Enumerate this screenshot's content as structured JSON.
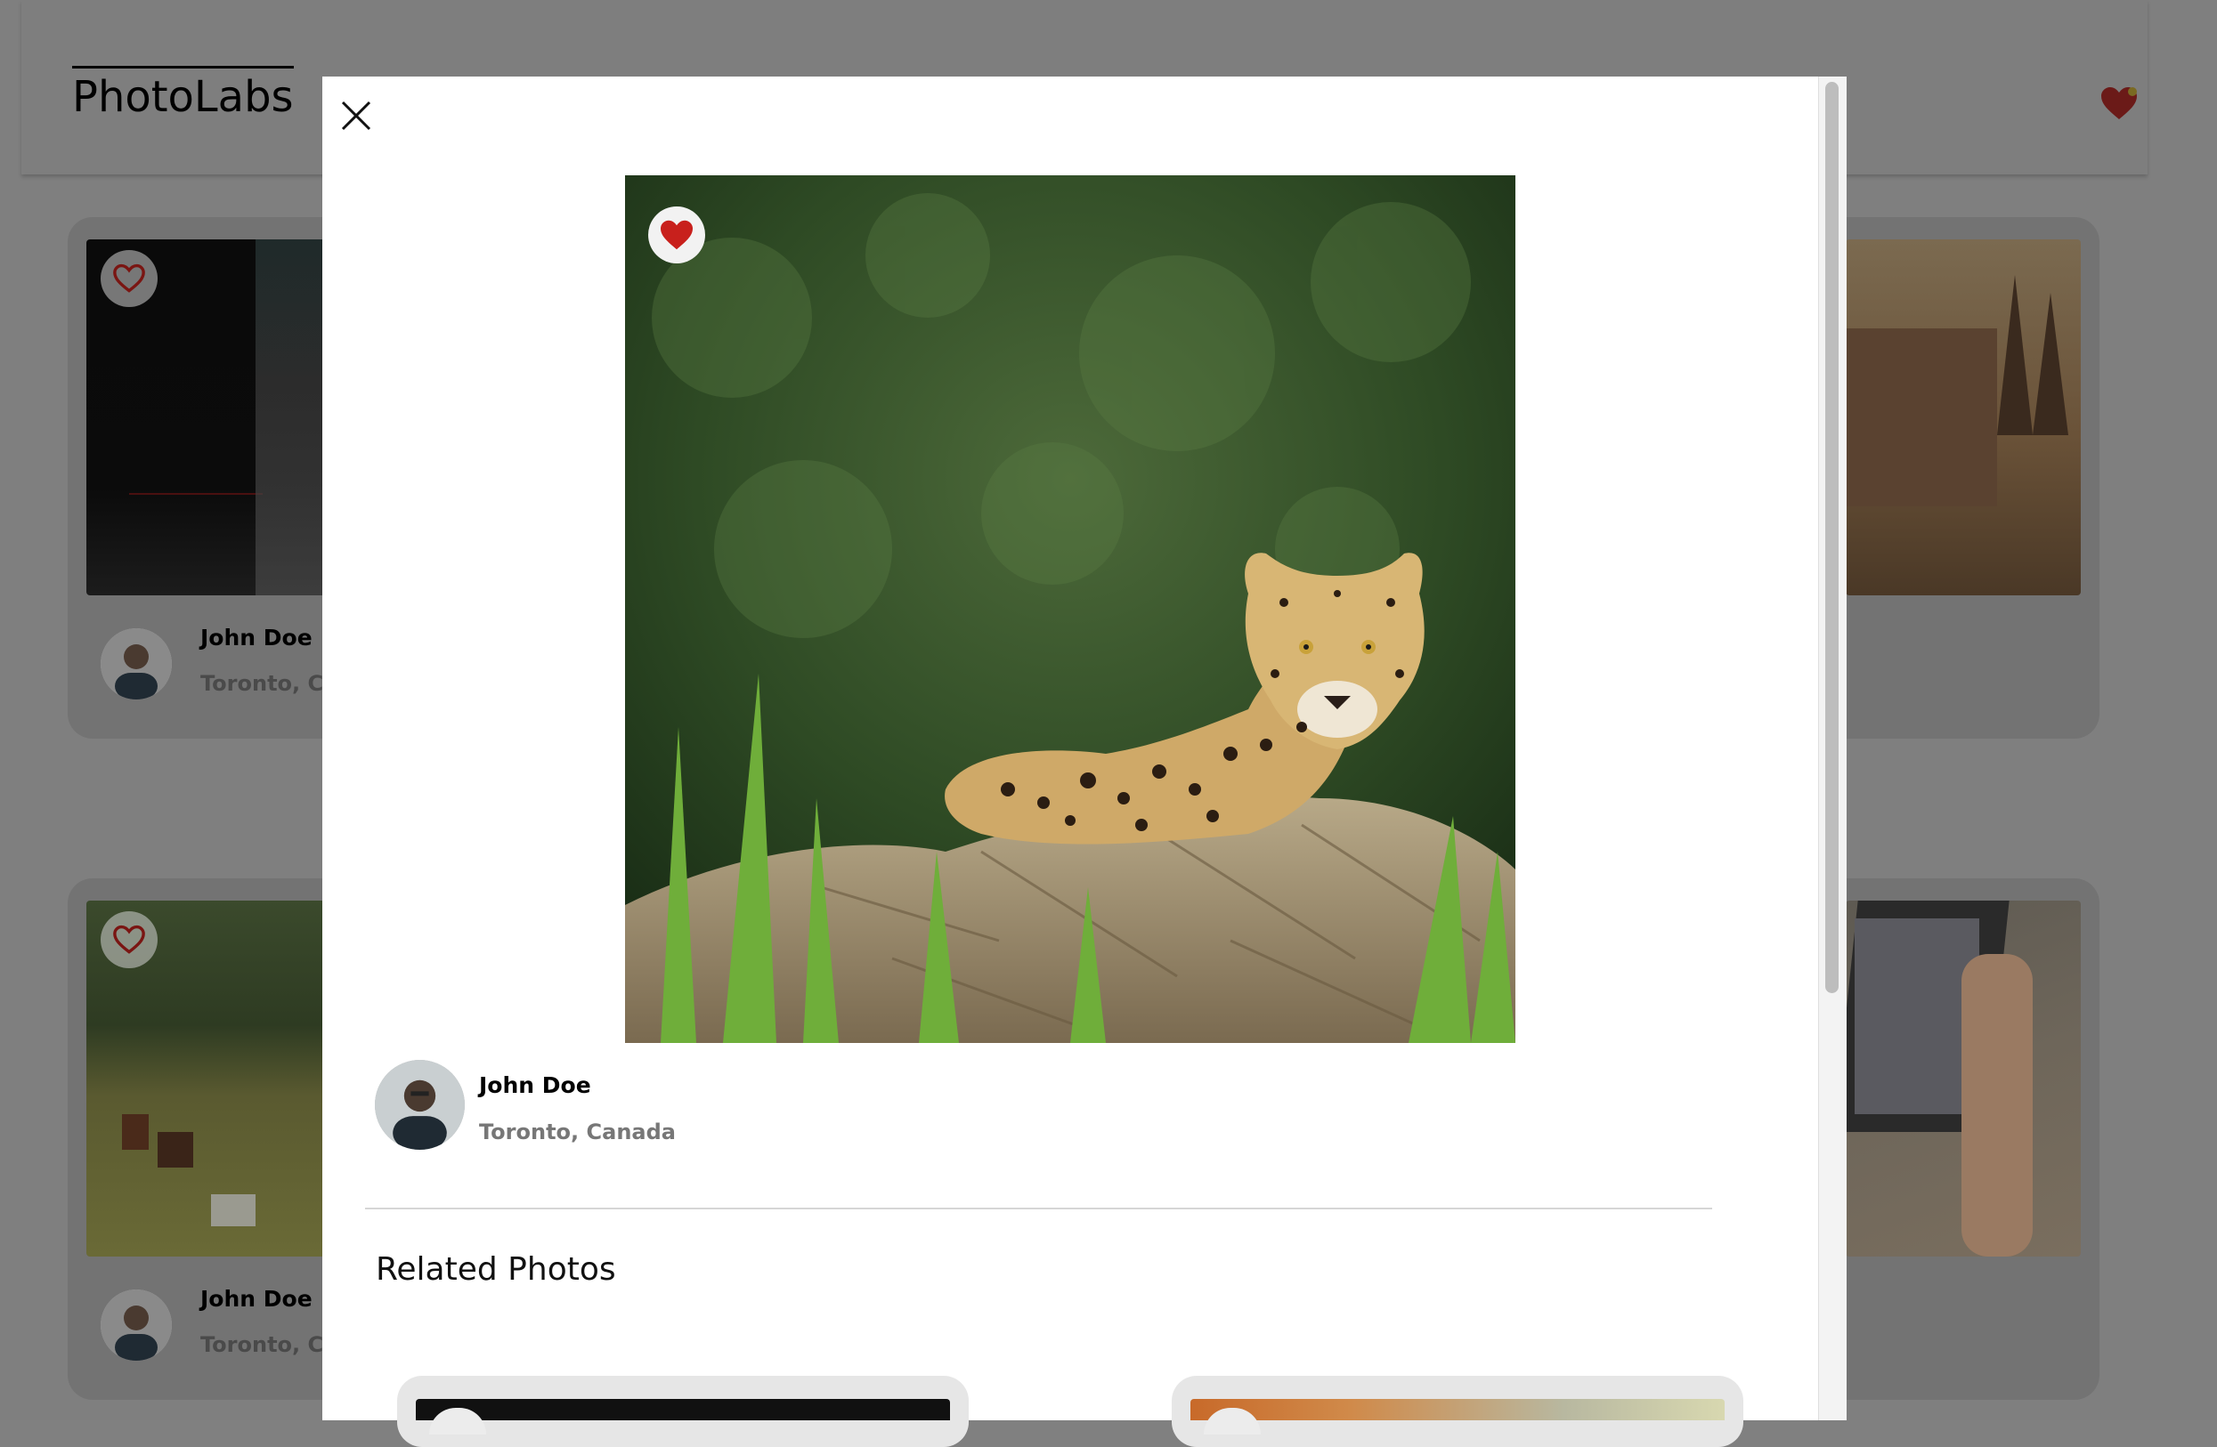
{
  "app": {
    "brand": "PhotoLabs"
  },
  "nav": {
    "fav_icon": "heart-icon",
    "has_notification": true
  },
  "background_cards": [
    {
      "user": {
        "name": "John Doe",
        "location": "Toronto, Canada"
      },
      "favourited": false
    },
    {
      "user": {
        "name": "John Doe",
        "location": "Toronto, Canada"
      },
      "favourited": false
    }
  ],
  "modal": {
    "close_icon": "close-icon",
    "photo": {
      "favourited": true,
      "subject": "jaguar"
    },
    "user": {
      "name": "John Doe",
      "location": "Toronto, Canada"
    },
    "related_title": "Related Photos"
  },
  "colors": {
    "heart_red": "#c8201c",
    "notification_dot": "#e3c22c"
  }
}
